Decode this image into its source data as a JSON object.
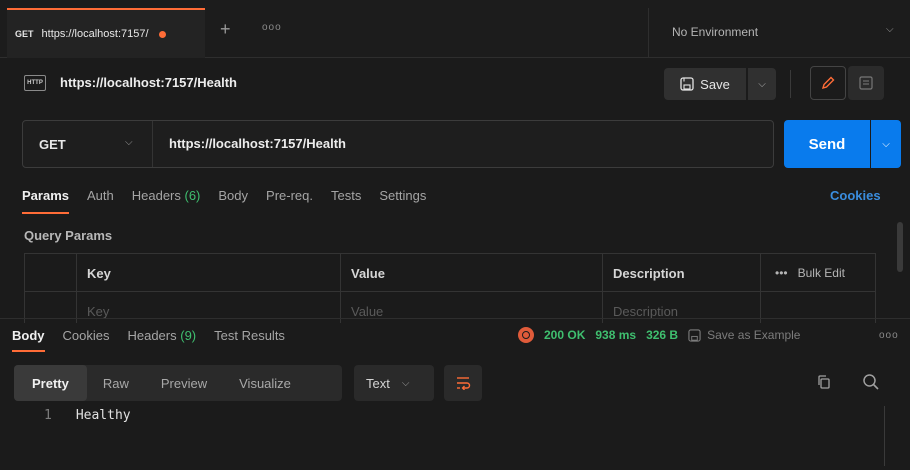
{
  "tab": {
    "method": "GET",
    "title": "https://localhost:7157/",
    "unsaved": true
  },
  "environment": {
    "label": "No Environment"
  },
  "request": {
    "icon_text": "HTTP",
    "name": "https://localhost:7157/Health",
    "save_label": "Save",
    "method": "GET",
    "url": "https://localhost:7157/Health",
    "send_label": "Send"
  },
  "request_tabs": {
    "params": "Params",
    "auth": "Auth",
    "headers": "Headers",
    "headers_count": "(6)",
    "body": "Body",
    "prereq": "Pre-req.",
    "tests": "Tests",
    "settings": "Settings",
    "cookies": "Cookies"
  },
  "query_params": {
    "title": "Query Params",
    "columns": {
      "key": "Key",
      "value": "Value",
      "description": "Description",
      "bulk_edit": "Bulk Edit"
    },
    "placeholders": {
      "key": "Key",
      "value": "Value",
      "description": "Description"
    }
  },
  "response": {
    "tabs": {
      "body": "Body",
      "cookies": "Cookies",
      "headers": "Headers",
      "headers_count": "(9)",
      "test_results": "Test Results"
    },
    "status": "200 OK",
    "time": "938 ms",
    "size": "326 B",
    "save_example": "Save as Example",
    "formats": {
      "pretty": "Pretty",
      "raw": "Raw",
      "preview": "Preview",
      "visualize": "Visualize"
    },
    "language": "Text",
    "lines": [
      {
        "no": "1",
        "text": "Healthy"
      }
    ]
  },
  "colors": {
    "accent": "#ff6c37",
    "send": "#097bed",
    "success": "#3fbf6f",
    "link": "#3a8dde"
  }
}
